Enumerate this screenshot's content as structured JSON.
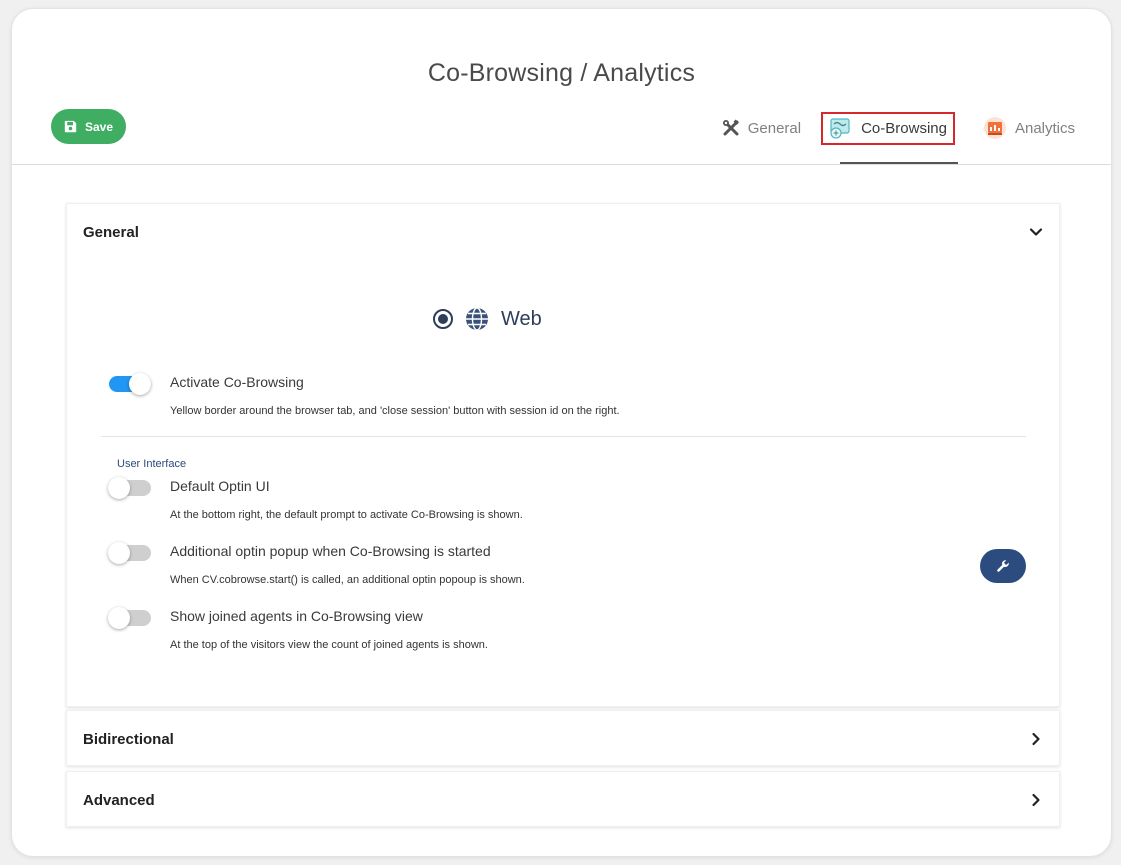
{
  "header": {
    "title": "Co-Browsing / Analytics",
    "save_label": "Save"
  },
  "tabs": [
    {
      "label": "General",
      "icon": "tools-icon"
    },
    {
      "label": "Co-Browsing",
      "icon": "cobrowsing-icon",
      "active": true
    },
    {
      "label": "Analytics",
      "icon": "analytics-icon"
    }
  ],
  "panels": {
    "general": {
      "title": "General",
      "channel": {
        "label": "Web",
        "selected": true
      },
      "activate": {
        "label": "Activate Co-Browsing",
        "desc": "Yellow border around the browser tab, and 'close session' button with session id on the right.",
        "on": true
      },
      "user_interface": {
        "label": "User Interface",
        "options": [
          {
            "label": "Default Optin UI",
            "desc": "At the bottom right, the default prompt to activate Co-Browsing is shown.",
            "on": false
          },
          {
            "label": "Additional optin popup when Co-Browsing is started",
            "desc": "When CV.cobrowse.start() is called, an additional optin popoup is shown.",
            "on": false
          },
          {
            "label": "Show joined agents in Co-Browsing view",
            "desc": "At the top of the visitors view the count of joined agents is shown.",
            "on": false
          }
        ]
      }
    },
    "bidirectional": {
      "title": "Bidirectional"
    },
    "advanced": {
      "title": "Advanced"
    }
  },
  "colors": {
    "save": "#3fae62",
    "toggle_on": "#2196f3",
    "accent_dark": "#2c4c80",
    "tab_highlight": "#d6262e"
  }
}
